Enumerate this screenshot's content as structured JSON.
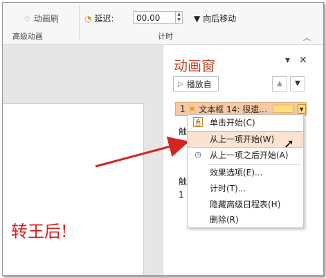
{
  "ribbon": {
    "animation_painter": "动画刷",
    "delay_label": "延迟:",
    "delay_value": "00.00",
    "move_later": "向后移动",
    "group_advanced": "高级动画",
    "group_timing": "计时"
  },
  "pane": {
    "title": "动画窗",
    "play_button": "播放自",
    "item_number": "1",
    "item_label": "文本框 14: 很遗...",
    "trigger_label_1": "触",
    "trigger_num_1": "1",
    "trigger_label_2": "触",
    "trigger_num_2": "1",
    "close_glyph": "✕",
    "pin_glyph": "▾"
  },
  "menu": {
    "items": [
      {
        "label": "单击开始(C)"
      },
      {
        "label": "从上一项开始(W)"
      },
      {
        "label": "从上一项之后开始(A)"
      },
      {
        "label": "效果选项(E)..."
      },
      {
        "label": "计时(T)..."
      },
      {
        "label": "隐藏高级日程表(H)"
      },
      {
        "label": "删除(R)"
      }
    ]
  },
  "slide": {
    "text": "转王后!"
  },
  "colors": {
    "accent": "#c9442a",
    "arrow": "#d42424",
    "highlight": "#fbe2d1"
  }
}
